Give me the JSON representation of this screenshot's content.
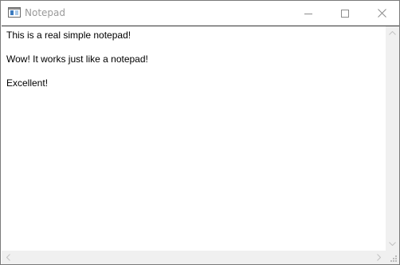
{
  "window": {
    "title": "Notepad",
    "icon": "notepad-app-icon"
  },
  "caption_buttons": {
    "minimize_icon": "minimize-icon",
    "maximize_icon": "maximize-icon",
    "close_icon": "close-icon"
  },
  "editor": {
    "lines": [
      "This is a real simple notepad!",
      "Wow! It works just like a notepad!",
      "Excellent!"
    ]
  },
  "colors": {
    "title_text": "#9a9a9a",
    "scrollbar_track": "#f0f0f0",
    "text": "#000000"
  }
}
